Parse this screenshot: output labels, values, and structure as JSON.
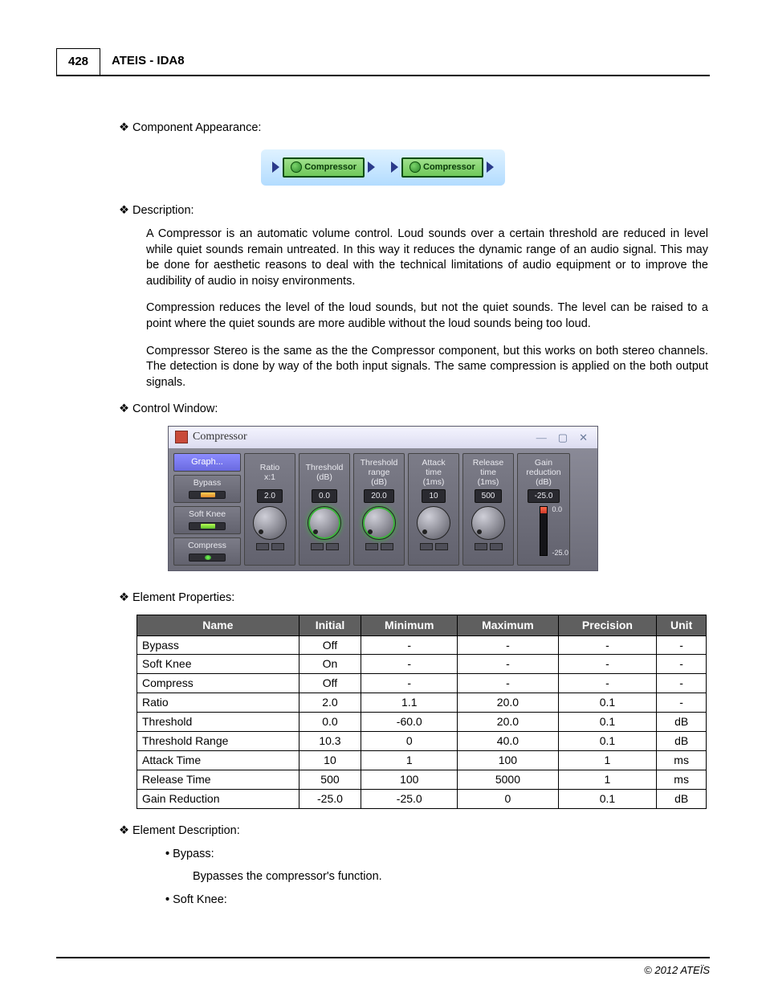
{
  "header": {
    "page_number": "428",
    "title": "ATEIS - IDA8"
  },
  "sections": {
    "appearance_label": "Component Appearance:",
    "description_label": "Description:",
    "control_window_label": "Control Window:",
    "element_properties_label": "Element Properties:",
    "element_description_label": "Element Description:"
  },
  "appearance": {
    "chip_label": "Compressor"
  },
  "description_paras": [
    "A Compressor is an automatic volume control. Loud sounds over a certain threshold are reduced in level while quiet sounds remain untreated. In this way it reduces the dynamic range of an audio signal. This may be done for aesthetic reasons to deal with the technical limitations of audio equipment or to improve the audibility of audio in noisy environments.",
    "Compression reduces the level of the loud sounds, but not the quiet sounds. The level can be raised to a point where the quiet sounds are more audible without the loud sounds being too loud.",
    "Compressor Stereo is the same as the the Compressor component, but this works on both stereo channels. The detection is done by way of the both input signals. The same compression is applied on the both output signals."
  ],
  "control_window": {
    "title": "Compressor",
    "left": {
      "graph": "Graph...",
      "bypass": "Bypass",
      "softknee": "Soft Knee",
      "compress": "Compress"
    },
    "knobs": [
      {
        "label": "Ratio\nx:1",
        "value": "2.0",
        "green": false
      },
      {
        "label": "Threshold\n(dB)",
        "value": "0.0",
        "green": true
      },
      {
        "label": "Threshold\nrange\n(dB)",
        "value": "20.0",
        "green": true
      },
      {
        "label": "Attack\ntime\n(1ms)",
        "value": "10",
        "green": false
      },
      {
        "label": "Release\ntime\n(1ms)",
        "value": "500",
        "green": false
      }
    ],
    "meter": {
      "label": "Gain\nreduction\n(dB)",
      "value": "-25.0",
      "top": "0.0",
      "bottom": "-25.0"
    }
  },
  "properties": {
    "headers": [
      "Name",
      "Initial",
      "Minimum",
      "Maximum",
      "Precision",
      "Unit"
    ],
    "rows": [
      [
        "Bypass",
        "Off",
        "-",
        "-",
        "-",
        "-"
      ],
      [
        "Soft Knee",
        "On",
        "-",
        "-",
        "-",
        "-"
      ],
      [
        "Compress",
        "Off",
        "-",
        "-",
        "-",
        "-"
      ],
      [
        "Ratio",
        "2.0",
        "1.1",
        "20.0",
        "0.1",
        "-"
      ],
      [
        "Threshold",
        "0.0",
        "-60.0",
        "20.0",
        "0.1",
        "dB"
      ],
      [
        "Threshold Range",
        "10.3",
        "0",
        "40.0",
        "0.1",
        "dB"
      ],
      [
        "Attack Time",
        "10",
        "1",
        "100",
        "1",
        "ms"
      ],
      [
        "Release Time",
        "500",
        "100",
        "5000",
        "1",
        "ms"
      ],
      [
        "Gain Reduction",
        "-25.0",
        "-25.0",
        "0",
        "0.1",
        "dB"
      ]
    ]
  },
  "element_descriptions": [
    {
      "name": "Bypass:",
      "body": "Bypasses the compressor's function."
    },
    {
      "name": "Soft Knee:",
      "body": ""
    }
  ],
  "footer": "© 2012 ATEÏS"
}
